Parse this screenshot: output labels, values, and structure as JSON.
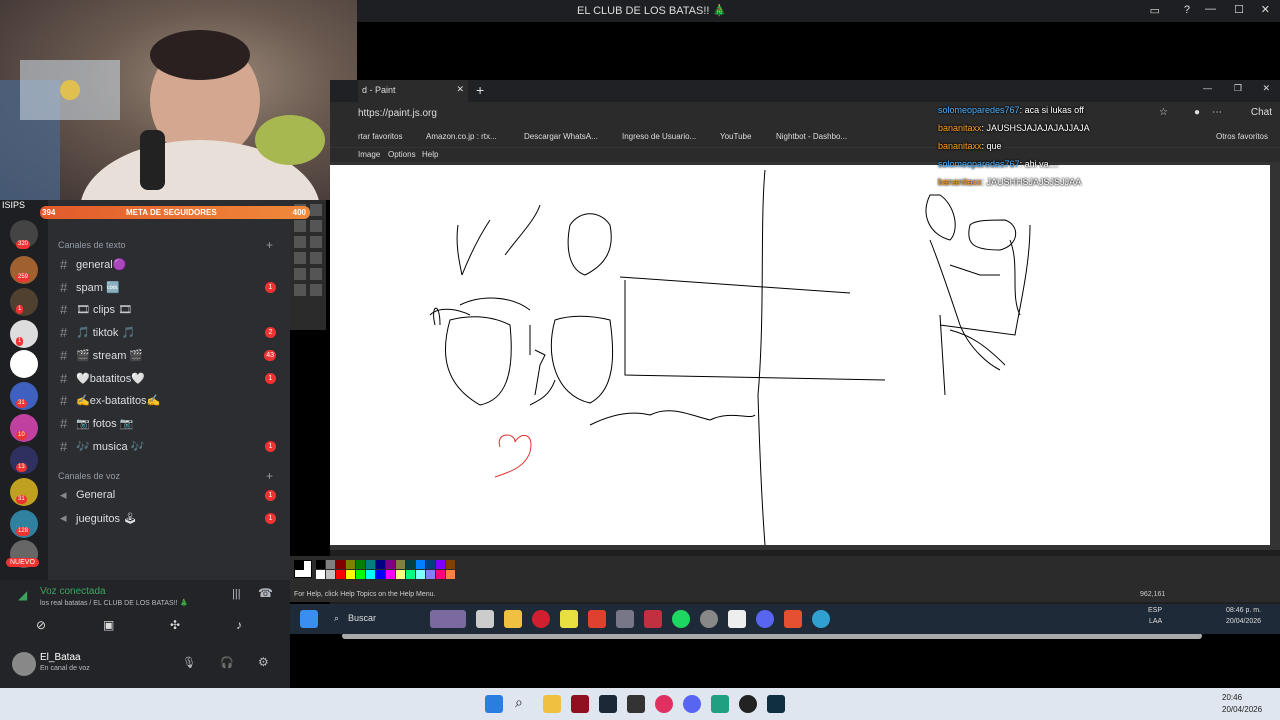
{
  "discord": {
    "window_title": "EL CLUB DE LOS BATAS!! 🎄",
    "follower_goal": {
      "label": "META DE SEGUIDORES",
      "current": "394",
      "target": "400"
    },
    "text_category": "Canales de texto",
    "voice_category": "Canales de voz",
    "channels": [
      {
        "name": "general🟣",
        "badge": ""
      },
      {
        "name": "spam 🆒",
        "badge": "1"
      },
      {
        "name": "🎞 clips 🎞",
        "badge": ""
      },
      {
        "name": "🎵 tiktok 🎵",
        "badge": "2"
      },
      {
        "name": "🎬 stream 🎬",
        "badge": "43"
      },
      {
        "name": "🤍batatitos🤍",
        "badge": "1"
      },
      {
        "name": "✍ex-batatitos✍",
        "badge": ""
      },
      {
        "name": "📷 fotos 📷",
        "badge": ""
      },
      {
        "name": "🎶 musica 🎶",
        "badge": "1"
      }
    ],
    "voice_channels": [
      {
        "name": "General",
        "badge": "1"
      },
      {
        "name": "jueguitos 🕹",
        "badge": "1"
      }
    ],
    "server_badges": [
      "320",
      "259",
      "1",
      "1",
      "31",
      "10",
      "13",
      "31",
      "128"
    ],
    "new_label": "NUEVO",
    "voice_status": "Voz conectada",
    "voice_location": "los real batatas / EL CLUB DE LOS BATAS!! 🎄",
    "user_name": "El_Bataa",
    "user_status": "En canal de voz",
    "server_label": "ISIPS"
  },
  "browser": {
    "tab_title": "d - Paint",
    "url": "https://paint.js.org",
    "bookmarks": [
      "rtar favoritos",
      "Amazon.co.jp : rtx...",
      "Descargar WhatsA...",
      "Ingreso de Usuario...",
      "YouTube",
      "Nightbot - Dashbo..."
    ],
    "other_bookmarks": "Otros favoritos",
    "chat_button": "Chat"
  },
  "paint": {
    "menu": [
      "Image",
      "Options",
      "Help"
    ],
    "status_help": "For Help, click Help Topics on the Help Menu.",
    "coords": "962,161",
    "palette": [
      "#000000",
      "#808080",
      "#800000",
      "#808000",
      "#008000",
      "#008080",
      "#000080",
      "#800080",
      "#808040",
      "#004040",
      "#0080ff",
      "#004080",
      "#8000ff",
      "#804000",
      "#ffffff",
      "#c0c0c0",
      "#ff0000",
      "#ffff00",
      "#00ff00",
      "#00ffff",
      "#0000ff",
      "#ff00ff",
      "#ffff80",
      "#00ff80",
      "#80ffff",
      "#8080ff",
      "#ff0080",
      "#ff8040"
    ]
  },
  "vm_taskbar": {
    "search_label": "Buscar",
    "lang": "ESP",
    "lang2": "LAA",
    "time": "08:46 p. m.",
    "date": "20/04/2026"
  },
  "chat": [
    {
      "user": "solomeoparedes767",
      "msg": ": aca si lukas off",
      "style": "u1"
    },
    {
      "user": "bananitaxx",
      "msg": ": JAUSHSJAJAJAJAJJAJA",
      "style": "u2"
    },
    {
      "user": "bananitaxx",
      "msg": ": que",
      "style": "u2"
    },
    {
      "user": "solomeoparedes767",
      "msg": ": ahi va....",
      "style": "u1"
    },
    {
      "user": "bananitaxx",
      "msg": ": JAUSHHSJAJSJSJJAA",
      "style": "u2"
    }
  ],
  "windows_taskbar": {
    "time": "20:46",
    "date": "20/04/2026"
  }
}
